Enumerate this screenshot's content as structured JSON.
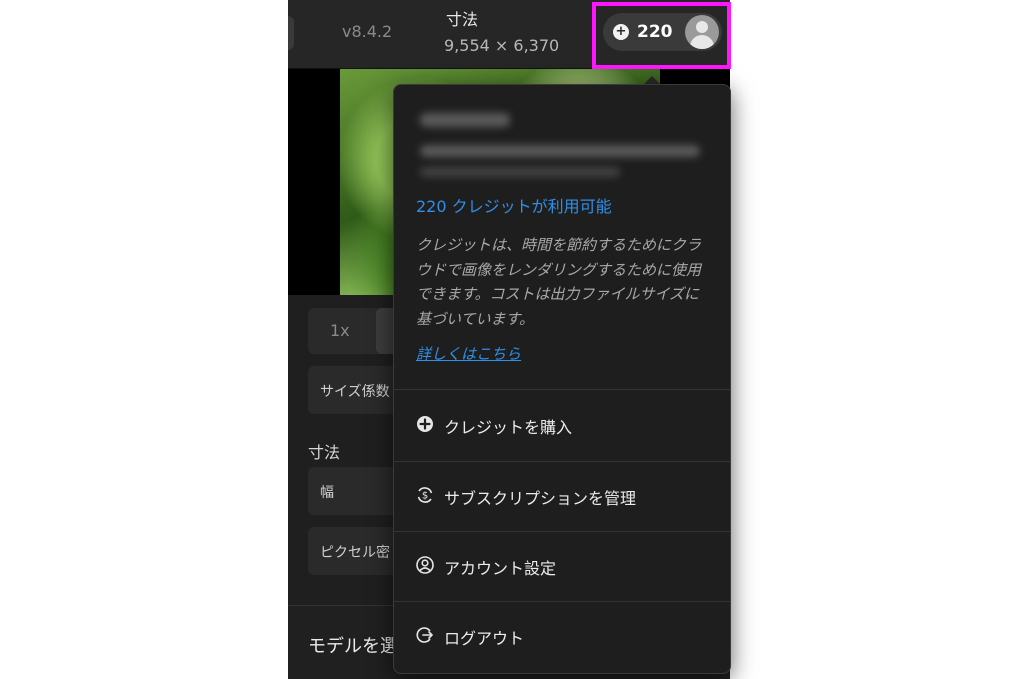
{
  "header": {
    "version": "v8.4.2",
    "dimensions_label": "寸法",
    "dimensions_value": "9,554 × 6,370",
    "credits": "220"
  },
  "panel": {
    "scale_option": "1x",
    "size_factor_label": "サイズ係数",
    "dimensions_section": "寸法",
    "width_label": "幅",
    "pixel_density_label": "ピクセル密",
    "model_select_label": "モデルを選"
  },
  "menu": {
    "credits_available": "220 クレジットが利用可能",
    "description": "クレジットは、時間を節約するためにクラウドで画像をレンダリングするために使用できます。コストは出力ファイルサイズに基づいています。",
    "learn_more": "詳しくはこちら",
    "items": [
      {
        "label": "クレジットを購入",
        "icon": "plus-circle-icon"
      },
      {
        "label": "サブスクリプションを管理",
        "icon": "refresh-dollar-icon"
      },
      {
        "label": "アカウント設定",
        "icon": "account-icon"
      },
      {
        "label": "ログアウト",
        "icon": "logout-icon"
      }
    ]
  },
  "colors": {
    "highlight": "#ff16ff",
    "link": "#2f8fe8",
    "background": "#1f1f1f"
  }
}
